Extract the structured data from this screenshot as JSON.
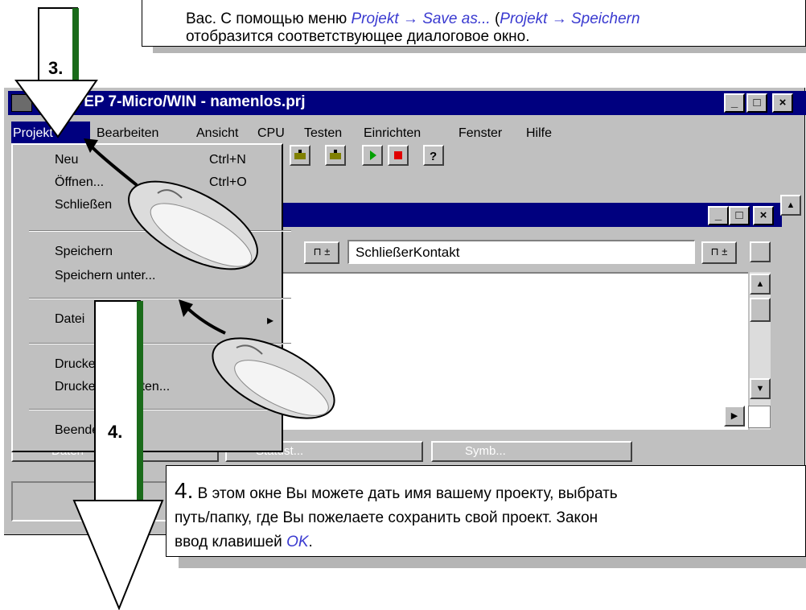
{
  "callout_top": {
    "line1_prefix": "Вас. С помощью меню ",
    "line1_link1": "Projekt → Save as...",
    "line1_mid": " (",
    "line1_link2": "Projekt → Speichern",
    "line2": "отобразится соответствующее диалоговое окно."
  },
  "window": {
    "title": "STEP 7-Micro/WIN - namenlos.prj",
    "controls": [
      "_",
      "□",
      "×"
    ]
  },
  "menubar": {
    "items": [
      "Projekt",
      "Bearbeiten",
      "Ansicht",
      "CPU",
      "Testen",
      "Einrichten",
      "Fenster",
      "Hilfe"
    ]
  },
  "dropdown": {
    "items": [
      {
        "label": "Neu",
        "shortcut": "Ctrl+N"
      },
      {
        "label": "Öffnen...",
        "shortcut": "Ctrl+O"
      },
      {
        "label": "Schließen"
      },
      {
        "label": "Speichern",
        "shortcut": ""
      },
      {
        "label": "Speichern unter..."
      },
      {
        "label": "Datei",
        "submenu": "▸"
      },
      {
        "label": "Drucken..."
      },
      {
        "label": "Drucker einrichten..."
      },
      {
        "label": "Beenden"
      }
    ]
  },
  "inner_window": {
    "field_text": "SchließerKontakt",
    "dropdown_glyph": "⊓ ±"
  },
  "bottom_panels": {
    "panel1": "Daten",
    "panel2": "Statust...",
    "panel3": "Symb..."
  },
  "steps": {
    "step3": "3.",
    "step4": "4."
  },
  "callout_bottom": {
    "number": "4.",
    "line1": " В этом окне Вы можете дать имя вашему проекту, выбрать",
    "line2": "путь/папку, где Вы пожелаете сохранить свой проект. Закон",
    "line3_prefix": "ввод  клавишей  ",
    "line3_link": "OK",
    "line3_suffix": "."
  }
}
